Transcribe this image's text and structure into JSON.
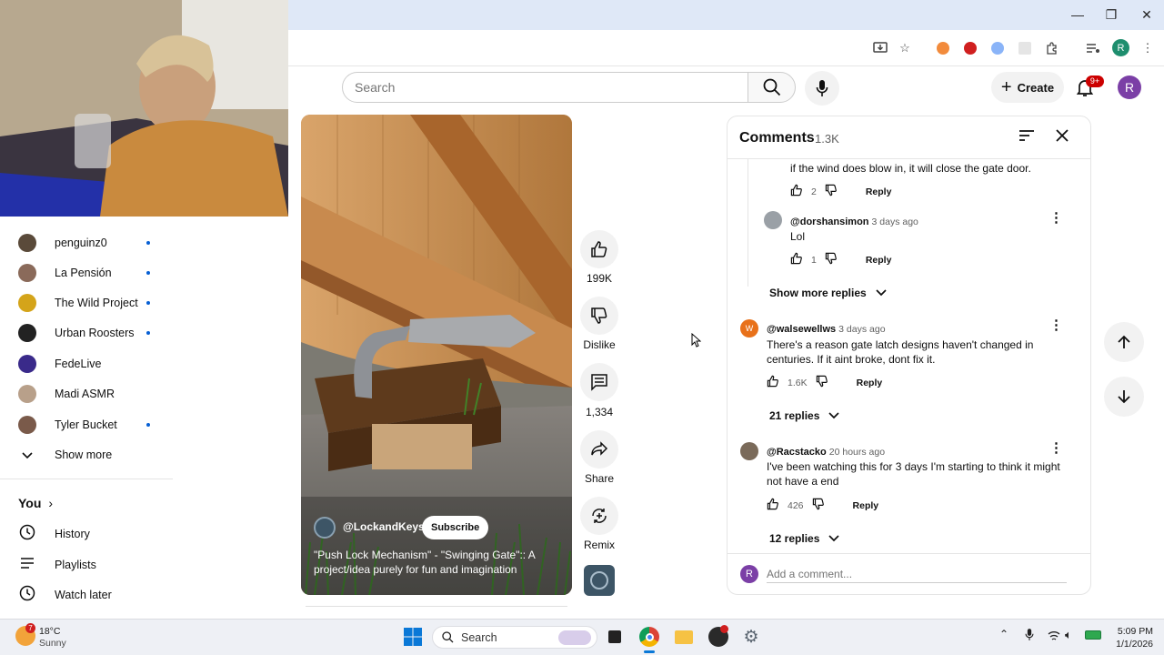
{
  "browser": {
    "window_controls": {
      "minimize": "—",
      "maximize": "❐",
      "close": "✕"
    },
    "profile_initial": "R"
  },
  "sidebar": {
    "subscriptions": [
      {
        "name": "penguinz0",
        "color": "#5a4a3a",
        "dot": true
      },
      {
        "name": "La Pensión",
        "color": "#8a6a5a",
        "dot": true
      },
      {
        "name": "The Wild Project",
        "color": "#d4a41a",
        "dot": true
      },
      {
        "name": "Urban Roosters",
        "color": "#222222",
        "dot": true
      },
      {
        "name": "FedeLive",
        "color": "#3a2a8a",
        "dot": false
      },
      {
        "name": "Madi ASMR",
        "color": "#b8a08a",
        "dot": false
      },
      {
        "name": "Tyler Bucket",
        "color": "#7a5a4a",
        "dot": true
      }
    ],
    "show_more": "Show more",
    "you_label": "You",
    "you_items": [
      {
        "label": "History",
        "icon": "history-icon"
      },
      {
        "label": "Playlists",
        "icon": "playlists-icon"
      },
      {
        "label": "Watch later",
        "icon": "watch-later-icon"
      }
    ]
  },
  "header": {
    "search_placeholder": "Search",
    "create_label": "Create",
    "notif_badge": "9+",
    "avatar_initial": "R"
  },
  "video": {
    "channel": "@LockandKeys",
    "subscribe_label": "Subscribe",
    "title": "\"Push Lock Mechanism\" - \"Swinging Gate\":: A project/idea purely for fun and imagination"
  },
  "actions": {
    "likes": "199K",
    "dislike_label": "Dislike",
    "comments_count": "1,334",
    "share_label": "Share",
    "remix_label": "Remix"
  },
  "comments": {
    "title": "Comments",
    "count": "1.3K",
    "top_fragment": {
      "text": "if the wind does blow in, it will close the gate door.",
      "likes": "2",
      "reply_label": "Reply"
    },
    "reply": {
      "handle": "@dorshansimon",
      "time": "3 days ago",
      "text": "Lol",
      "likes": "1",
      "reply_label": "Reply"
    },
    "show_more_replies": "Show more replies",
    "items": [
      {
        "handle": "@walsewellws",
        "time": "3 days ago",
        "text": "There's a reason gate latch designs haven't changed in centuries. If it aint broke, dont fix it.",
        "likes": "1.6K",
        "reply_label": "Reply",
        "replies": "21 replies",
        "avatar_color": "#e8711a",
        "avatar_letter": "W"
      },
      {
        "handle": "@Racstacko",
        "time": "20 hours ago",
        "text": "I've been watching this for 3 days I'm starting to think it might not have a end",
        "likes": "426",
        "reply_label": "Reply",
        "replies": "12 replies",
        "avatar_color": "#7a6a5a",
        "avatar_letter": ""
      }
    ],
    "add_placeholder": "Add a comment...",
    "user_initial": "R"
  },
  "taskbar": {
    "weather_temp": "18°C",
    "weather_desc": "Sunny",
    "weather_badge": "7",
    "search_label": "Search",
    "time": "5:09 PM",
    "date": "1/1/2026"
  }
}
